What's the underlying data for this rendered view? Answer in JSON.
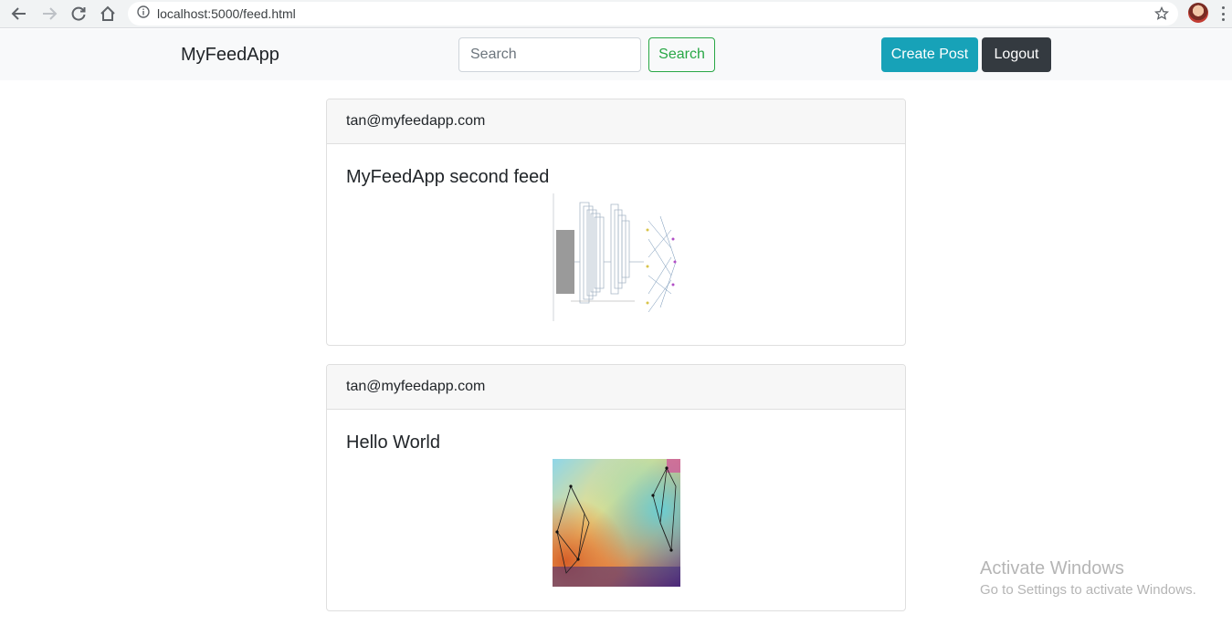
{
  "browser": {
    "url": "localhost:5000/feed.html",
    "icons": [
      "back-arrow-icon",
      "forward-arrow-icon",
      "reload-icon",
      "home-icon",
      "info-icon",
      "star-icon",
      "profile-avatar",
      "more-vert-icon"
    ]
  },
  "navbar": {
    "brand": "MyFeedApp",
    "search_placeholder": "Search",
    "search_value": "",
    "search_button": "Search",
    "create_post_button": "Create Post",
    "logout_button": "Logout",
    "colors": {
      "search_outline": "#28a745",
      "create": "#17a2b8",
      "logout": "#343a40"
    }
  },
  "posts": [
    {
      "author": "tan@myfeedapp.com",
      "title": "MyFeedApp second feed",
      "image": "neural-network-diagram-image"
    },
    {
      "author": "tan@myfeedapp.com",
      "title": "Hello World",
      "image": "colorful-polygon-network-image"
    }
  ],
  "watermark": {
    "line1": "Activate Windows",
    "line2": "Go to Settings to activate Windows."
  }
}
